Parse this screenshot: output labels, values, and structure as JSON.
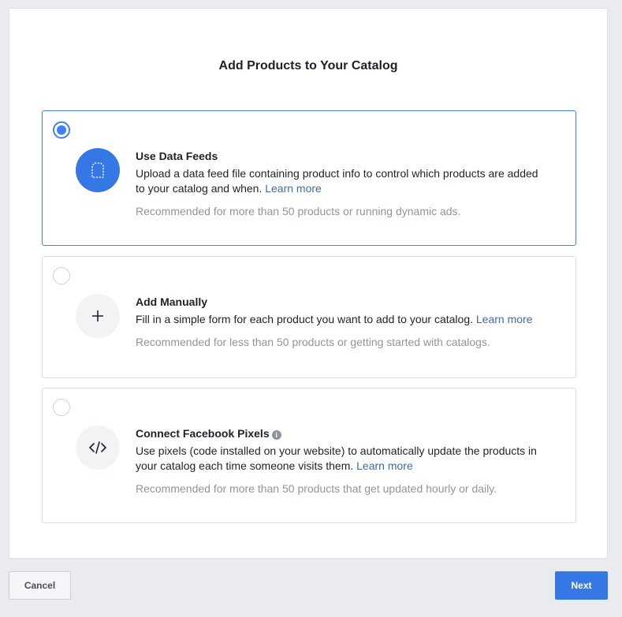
{
  "dialog": {
    "title": "Add Products to Your Catalog"
  },
  "options": [
    {
      "title": "Use Data Feeds",
      "description": "Upload a data feed file containing product info to control which products are added to your catalog and when.",
      "link": "Learn more",
      "recommendation": "Recommended for more than 50 products or running dynamic ads.",
      "icon": "document-icon",
      "selected": true
    },
    {
      "title": "Add Manually",
      "description": "Fill in a simple form for each product you want to add to your catalog.",
      "link": "Learn more",
      "recommendation": "Recommended for less than 50 products or getting started with catalogs.",
      "icon": "plus-icon",
      "selected": false
    },
    {
      "title": "Connect Facebook Pixels",
      "description": "Use pixels (code installed on your website) to automatically update the products in your catalog each time someone visits them.",
      "link": "Learn more",
      "recommendation": "Recommended for more than 50 products that get updated hourly or daily.",
      "icon": "code-icon",
      "info_icon": "info-icon",
      "selected": false
    }
  ],
  "footer": {
    "cancel_label": "Cancel",
    "next_label": "Next"
  },
  "colors": {
    "accent": "#3578e5",
    "selected_border": "#4080ff",
    "link": "#4267b2",
    "muted_text": "#90949c",
    "page_background": "#e9ebee"
  }
}
